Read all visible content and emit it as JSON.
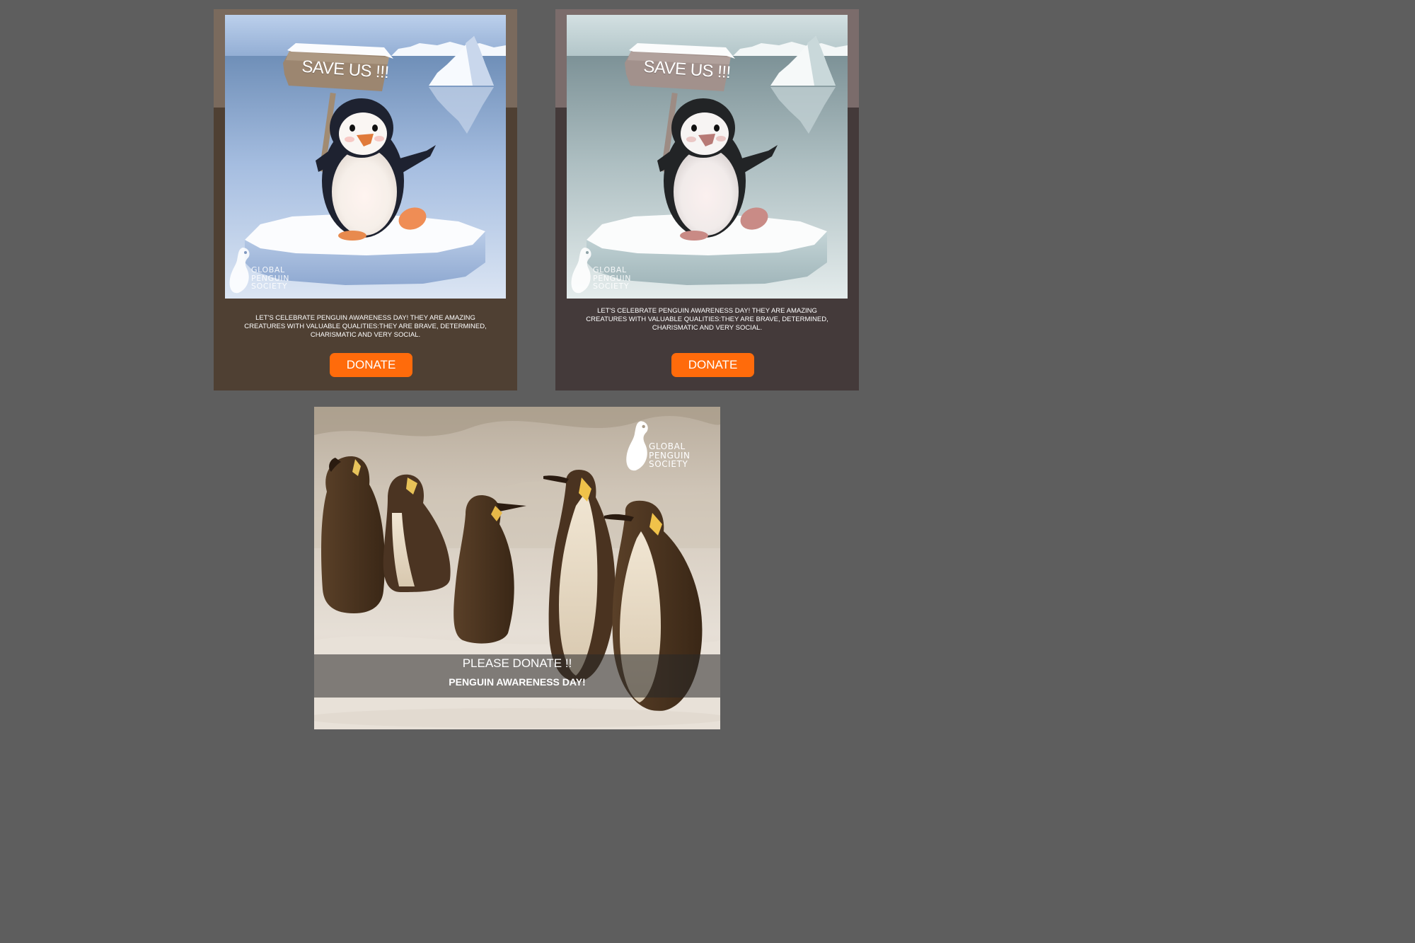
{
  "ads": [
    {
      "variant": "warm-brown",
      "sign_text": "SAVE US !!!",
      "logo": {
        "line1": "GLOBAL",
        "line2": "PENGUIN",
        "line3": "SOCIETY"
      },
      "body_text": "LET'S CELEBRATE PENGUIN AWARENESS DAY! THEY ARE AMAZING CREATURES WITH VALUABLE QUALITIES:THEY ARE BRAVE, DETERMINED, CHARISMATIC AND VERY SOCIAL.",
      "button_label": "DONATE",
      "colors": {
        "band": "#7a6a5d",
        "body": "#4f4033",
        "sky": "#a9bedc",
        "button": "#ff6b0b"
      }
    },
    {
      "variant": "cool-grey",
      "sign_text": "SAVE US !!!",
      "logo": {
        "line1": "GLOBAL",
        "line2": "PENGUIN",
        "line3": "SOCIETY"
      },
      "body_text": "LET'S CELEBRATE PENGUIN AWARENESS DAY! THEY ARE AMAZING CREATURES WITH VALUABLE QUALITIES:THEY ARE BRAVE, DETERMINED, CHARISMATIC AND VERY SOCIAL.",
      "button_label": "DONATE",
      "colors": {
        "band": "#7b6c6b",
        "body": "#443a3a",
        "sky": "#b8ccce",
        "button": "#ff6b0b"
      }
    }
  ],
  "photo_banner": {
    "logo": {
      "line1": "GLOBAL",
      "line2": "PENGUIN",
      "line3": "SOCIETY"
    },
    "headline": "PLEASE DONATE !!",
    "subline": "PENGUIN AWARENESS DAY!"
  },
  "page_background": "#5e5e5e"
}
